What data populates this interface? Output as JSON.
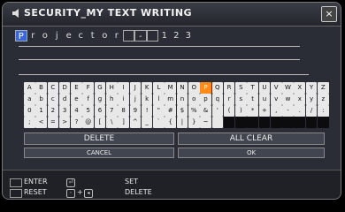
{
  "window": {
    "title": "SECURITY_MY TEXT WRITING",
    "close_label": "×"
  },
  "entry": {
    "cursor_char": "P",
    "chars": [
      "r",
      "o",
      "j",
      "e",
      "c",
      "t",
      "o",
      "r",
      " ",
      "-",
      " ",
      "1",
      "2",
      "3"
    ]
  },
  "keyboard": {
    "selected_key": "P",
    "rows": [
      [
        "A",
        "B",
        "C",
        "D",
        "E",
        "F",
        "G",
        "H",
        "I",
        "J",
        "K",
        "L",
        "M",
        "N",
        "O",
        "P",
        "Q",
        "R",
        "S",
        "T",
        "U",
        "V",
        "W",
        "X",
        "Y",
        "Z"
      ],
      [
        "a",
        "b",
        "c",
        "d",
        "e",
        "f",
        "g",
        "h",
        "i",
        "j",
        "k",
        "l",
        "m",
        "n",
        "o",
        "p",
        "q",
        "r",
        "s",
        "t",
        "u",
        "v",
        "w",
        "x",
        "y",
        "z"
      ],
      [
        "0",
        "1",
        "2",
        "3",
        "4",
        "5",
        "6",
        "7",
        "8",
        "9",
        "!",
        "\"",
        "#",
        "$",
        "%",
        "&",
        "'",
        "(",
        ")",
        "*",
        "+",
        ",",
        "-",
        ".",
        "/",
        ":"
      ],
      [
        ";",
        "<",
        "=",
        ">",
        "?",
        "@",
        "[",
        "\\",
        "]",
        "^",
        "_",
        "`",
        "{",
        "|",
        "}",
        "~",
        " ",
        "",
        "",
        "",
        "",
        "",
        "",
        "",
        "",
        ""
      ]
    ]
  },
  "buttons": {
    "delete": "DELETE",
    "all_clear": "ALL CLEAR",
    "cancel": "CANCEL",
    "ok": "OK"
  },
  "footer": {
    "enter": "ENTER",
    "reset": "RESET",
    "set": "SET",
    "delete": "DELETE"
  }
}
